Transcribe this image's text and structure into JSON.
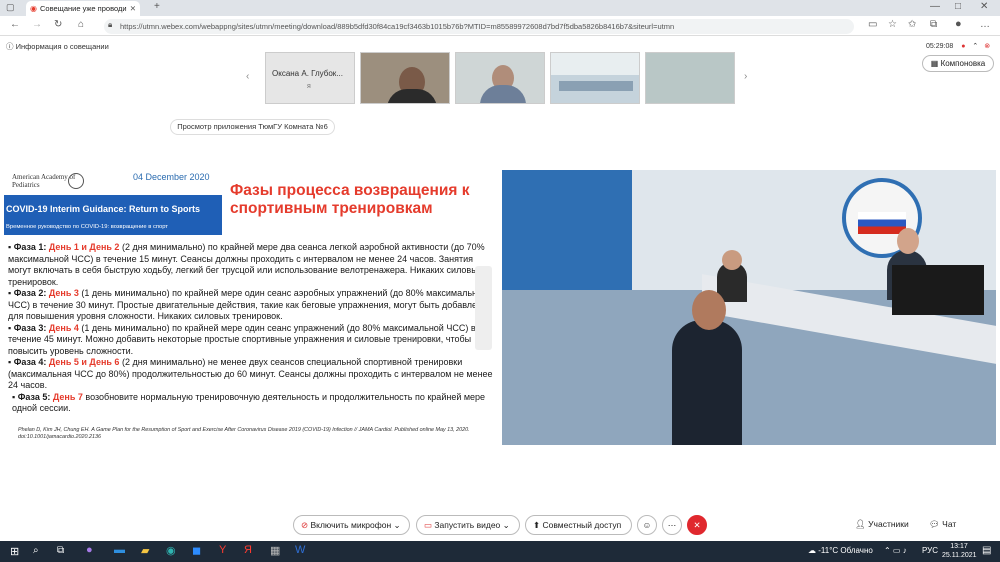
{
  "browser": {
    "tab_title": "Совещание уже проводи",
    "url": "https://utmn.webex.com/webappng/sites/utmn/meeting/download/889b5dfd30f84ca19cf3463b1015b76b?MTID=m85589972608d7bd7f5dba5826b8416b7&siteurl=utmn"
  },
  "meeting": {
    "info_label": "Информация о совещании",
    "time": "05:29:08",
    "layout_label": "Компоновка",
    "participant_name": "Оксана А. Глубок...",
    "share_banner": "Просмотр приложения ТюмГУ Комната №6"
  },
  "slide": {
    "org": "American Academy of Pediatrics",
    "date": "04 December 2020",
    "guidance_title": "COVID-19 Interim Guidance: Return to Sports",
    "guidance_sub": "Временное руководство по COVID-19: возвращение в спорт",
    "title": "Фазы процесса возвращения к спортивным тренировкам",
    "phases": [
      {
        "label": "Фаза 1:",
        "days": "День 1 и День 2",
        "text": "(2 дня минимально) по крайней мере два сеанса легкой аэробной активности (до 70% максимальной ЧСС) в течение 15 минут. Сеансы должны проходить с интервалом не менее 24 часов. Занятия могут включать в себя быструю ходьбу, легкий бег трусцой или использование велотренажера. Никаких силовых тренировок."
      },
      {
        "label": "Фаза 2:",
        "days": "День 3",
        "text": "(1 день минимально) по крайней мере один сеанс аэробных упражнений (до 80% максимальной  ЧСС) в течение 30 минут. Простые двигательные действия, такие как беговые упражнения, могут быть добавлены для повышения уровня сложности. Никаких силовых тренировок."
      },
      {
        "label": "Фаза 3:",
        "days": "День 4",
        "text": "(1 день минимально) по крайней мере один сеанс упражнений (до 80% максимальной  ЧСС) в течение 45 минут. Можно добавить некоторые простые спортивные упражнения и силовые тренировки, чтобы повысить уровень сложности."
      },
      {
        "label": "Фаза 4:",
        "days": "День 5 и День 6",
        "text": "(2 дня минимально) не менее двух сеансов специальной спортивной тренировки (максимальная ЧСС до 80%) продолжительностью до 60 минут. Сеансы должны проходить с интервалом не менее 24 часов."
      },
      {
        "label": "Фаза 5:",
        "days": "День 7",
        "text": "возобновите нормальную тренировочную деятельность и продолжительность по крайней мере одной сессии."
      }
    ],
    "reference": "Phelan D, Kim JH, Chung EH. A Game Plan for the Resumption of Sport and Exercise After Coronavirus Disease 2019 (COVID-19) Infection //  JAMA Cardiol. Published online May 13, 2020. doi:10.1001/jamacardio.2020.2136"
  },
  "controls": {
    "mic": "Включить микрофон",
    "video": "Запустить видео",
    "share": "Совместный доступ",
    "participants": "Участники",
    "chat": "Чат"
  },
  "taskbar": {
    "weather": "-11°C  Облачно",
    "lang": "РУС",
    "time": "13:17",
    "date": "25.11.2021"
  },
  "colors": {
    "accent": "#1f5fb6",
    "red": "#e53b2c"
  }
}
